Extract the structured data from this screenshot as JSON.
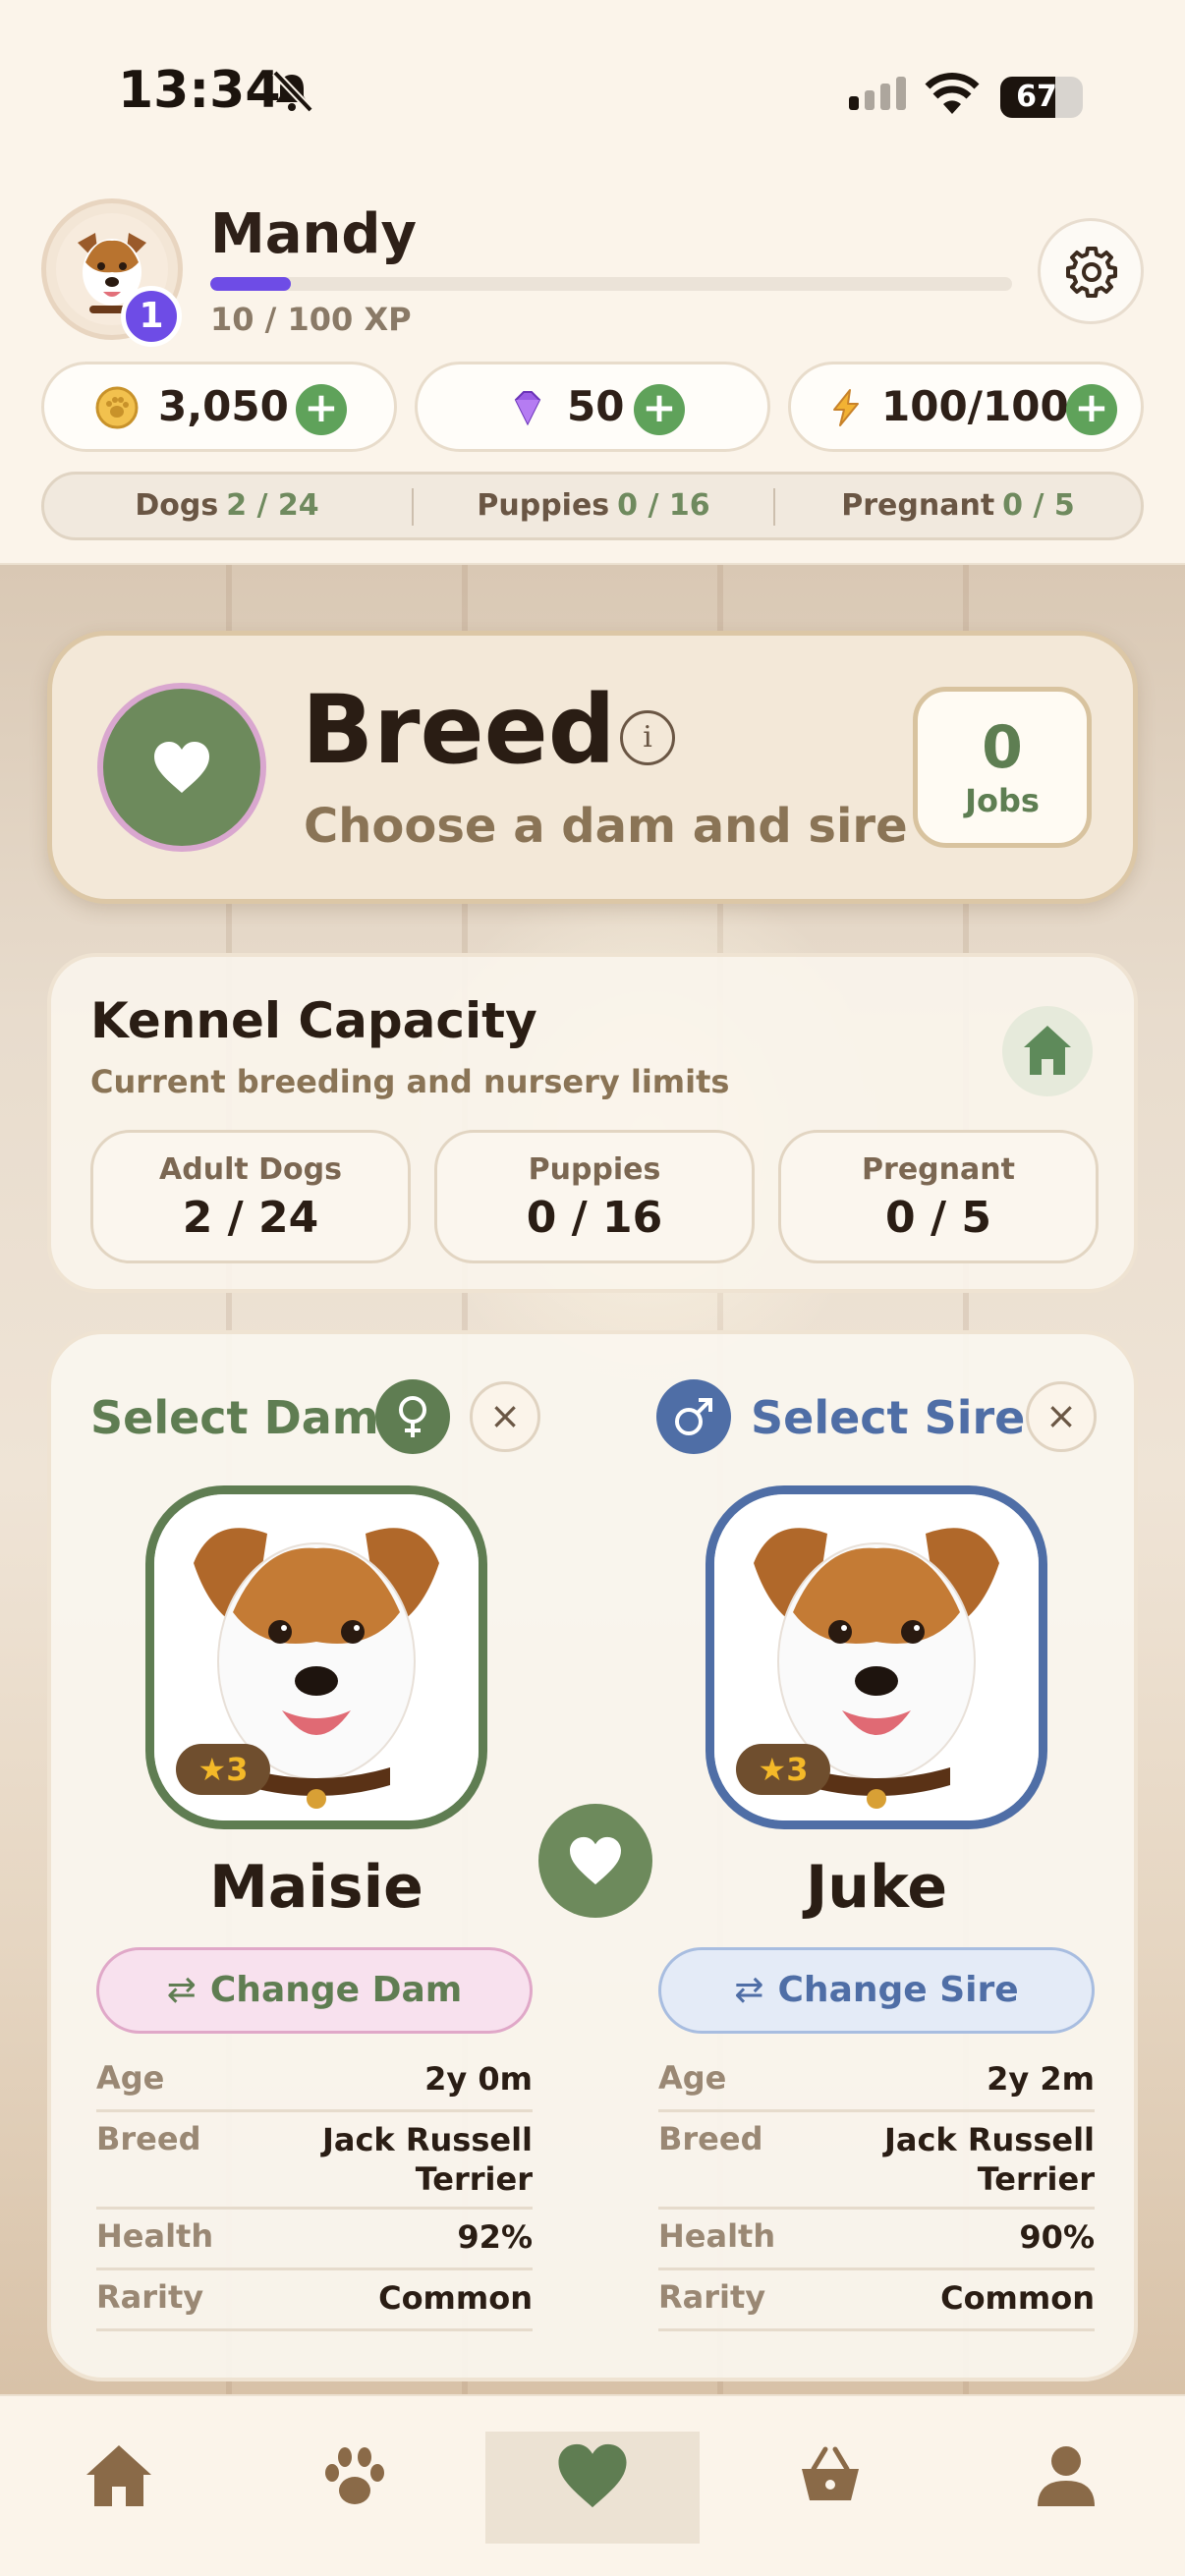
{
  "status_bar": {
    "time": "13:34",
    "battery_percent": 67,
    "battery_label": "67"
  },
  "profile": {
    "name": "Mandy",
    "level": "1",
    "xp_label": "10 / 100 XP",
    "xp_fraction": 0.1
  },
  "currencies": [
    {
      "icon": "paw-coin-icon",
      "value": "3,050"
    },
    {
      "icon": "gem-icon",
      "value": "50"
    },
    {
      "icon": "energy-icon",
      "value": "100/100"
    }
  ],
  "counts": [
    {
      "label": "Dogs",
      "value": "2 / 24"
    },
    {
      "label": "Puppies",
      "value": "0 / 16"
    },
    {
      "label": "Pregnant",
      "value": "0 / 5"
    }
  ],
  "breed": {
    "title": "Breed",
    "info_glyph": "i",
    "subtitle": "Choose a dam and sire",
    "jobs_count": "0",
    "jobs_label": "Jobs"
  },
  "kennel": {
    "title": "Kennel Capacity",
    "subtitle": "Current breeding and nursery limits",
    "stats": [
      {
        "label": "Adult Dogs",
        "value": "2 / 24"
      },
      {
        "label": "Puppies",
        "value": "0 / 16"
      },
      {
        "label": "Pregnant",
        "value": "0 / 5"
      }
    ]
  },
  "pairing": {
    "dam": {
      "select_label": "Select Dam",
      "name": "Maisie",
      "stars": "3",
      "change_label": "Change Dam",
      "info": [
        {
          "key": "Age",
          "value": "2y 0m"
        },
        {
          "key": "Breed",
          "value": "Jack Russell Terrier"
        },
        {
          "key": "Health",
          "value": "92%"
        },
        {
          "key": "Rarity",
          "value": "Common"
        }
      ]
    },
    "sire": {
      "select_label": "Select Sire",
      "name": "Juke",
      "stars": "3",
      "change_label": "Change Sire",
      "info": [
        {
          "key": "Age",
          "value": "2y 2m"
        },
        {
          "key": "Breed",
          "value": "Jack Russell Terrier"
        },
        {
          "key": "Health",
          "value": "90%"
        },
        {
          "key": "Rarity",
          "value": "Common"
        }
      ]
    }
  },
  "tabbar": {
    "items": [
      "home-icon",
      "paw-icon",
      "heart-icon",
      "basket-icon",
      "profile-icon"
    ],
    "active": "heart-icon"
  },
  "colors": {
    "accent_green": "#6d8a5c",
    "dam_green": "#5f7d52",
    "sire_blue": "#4f6ea6",
    "xp_purple": "#6e4ce6",
    "dam_btn_bg": "#f8e1ee",
    "sire_btn_bg": "#e4ebf7"
  }
}
